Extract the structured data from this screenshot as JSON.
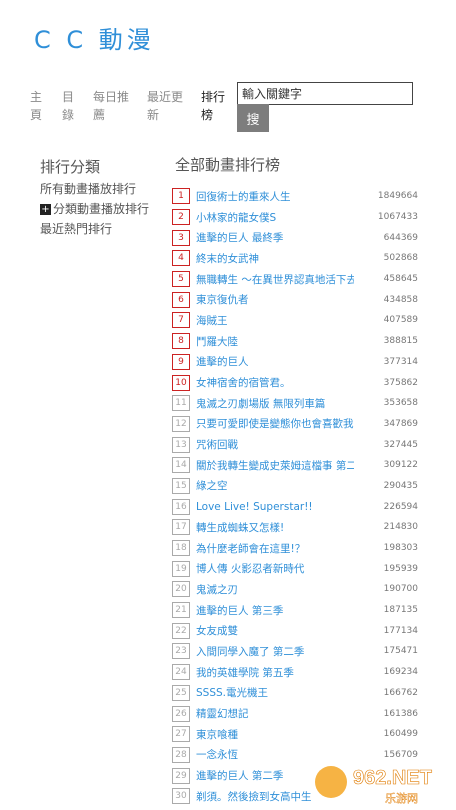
{
  "site": {
    "logo": "C C 動漫"
  },
  "nav": [
    {
      "line1": "主",
      "line2": "頁"
    },
    {
      "line1": "目",
      "line2": "錄"
    },
    {
      "line1": "每日推",
      "line2": "薦"
    },
    {
      "line1": "最近更",
      "line2": "新"
    },
    {
      "line1": "排行",
      "line2": "榜"
    }
  ],
  "search": {
    "placeholder": "輸入關鍵字",
    "button": "搜"
  },
  "sidebar": {
    "title": "排行分類",
    "items": [
      "所有動畫播放排行",
      "分類動畫播放排行",
      "最近熱門排行"
    ],
    "plus_symbol": "+"
  },
  "main": {
    "title": "全部動畫排行榜",
    "rows": [
      {
        "rank": "1",
        "name": "回復術士的重來人生",
        "count": "1849664"
      },
      {
        "rank": "2",
        "name": "小林家的龍女僕S",
        "count": "1067433"
      },
      {
        "rank": "3",
        "name": "進擊的巨人 最終季",
        "count": "644369"
      },
      {
        "rank": "4",
        "name": "終末的女武神",
        "count": "502868"
      },
      {
        "rank": "5",
        "name": "無職轉生 ～在異世界認真地活下去～",
        "count": "458645"
      },
      {
        "rank": "6",
        "name": "東京復仇者",
        "count": "434858"
      },
      {
        "rank": "7",
        "name": "海賊王",
        "count": "407589"
      },
      {
        "rank": "8",
        "name": "鬥羅大陸",
        "count": "388815"
      },
      {
        "rank": "9",
        "name": "進擊的巨人",
        "count": "377314"
      },
      {
        "rank": "10",
        "name": "女神宿舍的宿管君。",
        "count": "375862"
      },
      {
        "rank": "11",
        "name": "鬼滅之刃劇場版 無限列車篇",
        "count": "353658"
      },
      {
        "rank": "12",
        "name": "只要可愛即使是變態你也會喜歡我嗎？",
        "count": "347869"
      },
      {
        "rank": "13",
        "name": "咒術回戰",
        "count": "327445"
      },
      {
        "rank": "14",
        "name": "關於我轉生變成史萊姆這檔事 第二季",
        "count": "309122"
      },
      {
        "rank": "15",
        "name": "綠之空",
        "count": "290435"
      },
      {
        "rank": "16",
        "name": "Love Live! Superstar!!",
        "count": "226594"
      },
      {
        "rank": "17",
        "name": "轉生成蜘蛛又怎樣!",
        "count": "214830"
      },
      {
        "rank": "18",
        "name": "為什麼老師會在這里!？",
        "count": "198303"
      },
      {
        "rank": "19",
        "name": "博人傳 火影忍者新時代",
        "count": "195939"
      },
      {
        "rank": "20",
        "name": "鬼滅之刃",
        "count": "190700"
      },
      {
        "rank": "21",
        "name": "進擊的巨人 第三季",
        "count": "187135"
      },
      {
        "rank": "22",
        "name": "女友成雙",
        "count": "177134"
      },
      {
        "rank": "23",
        "name": "入間同學入魔了 第二季",
        "count": "175471"
      },
      {
        "rank": "24",
        "name": "我的英雄學院 第五季",
        "count": "169234"
      },
      {
        "rank": "25",
        "name": "SSSS.電光機王",
        "count": "166762"
      },
      {
        "rank": "26",
        "name": "精靈幻想記",
        "count": "161386"
      },
      {
        "rank": "27",
        "name": "東京喰種",
        "count": "160499"
      },
      {
        "rank": "28",
        "name": "一念永恆",
        "count": "156709"
      },
      {
        "rank": "29",
        "name": "進擊的巨人 第二季",
        "count": ""
      },
      {
        "rank": "30",
        "name": "剃須。然後撿到女高中生",
        "count": ""
      }
    ]
  },
  "watermark": {
    "brand": "962.NET",
    "sub": "乐游网"
  },
  "colors": {
    "accent": "#2f8fd8",
    "rank_red": "#cc2222",
    "rank_gray": "#aaaaaa",
    "button_gray": "#7d7d7d"
  }
}
